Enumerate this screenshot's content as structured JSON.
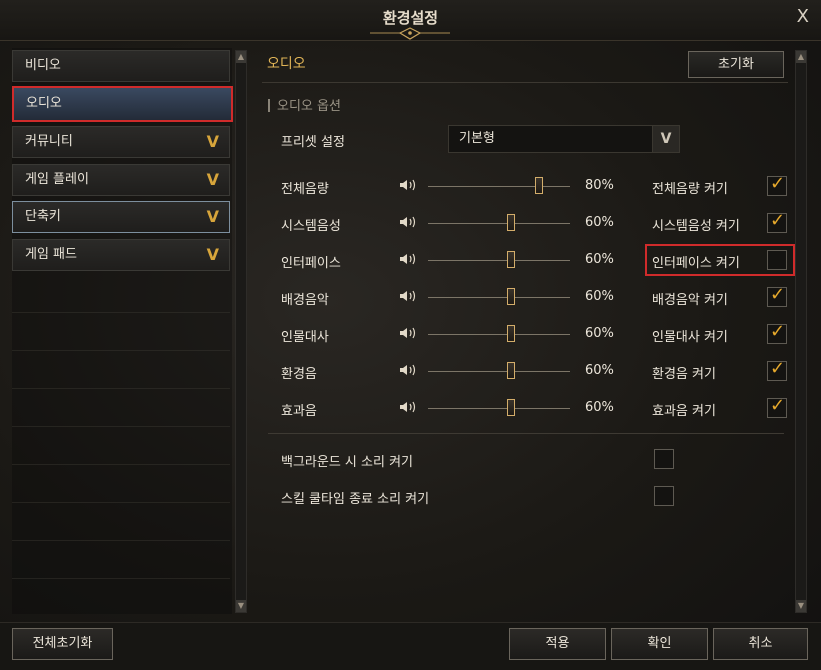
{
  "window": {
    "title": "환경설정",
    "close": "X"
  },
  "sidebar": {
    "items": [
      {
        "label": "비디오",
        "chevron": ""
      },
      {
        "label": "오디오",
        "chevron": ""
      },
      {
        "label": "커뮤니티",
        "chevron": "V"
      },
      {
        "label": "게임 플레이",
        "chevron": "V"
      },
      {
        "label": "단축키",
        "chevron": "V"
      },
      {
        "label": "게임 패드",
        "chevron": "V"
      }
    ],
    "selected": "오디오"
  },
  "content": {
    "section_title": "오디오",
    "reset_label": "초기화",
    "subheading": "오디오 옵션",
    "preset": {
      "label": "프리셋 설정",
      "value": "기본형",
      "dropdown_icon": "V"
    },
    "channels": [
      {
        "name": "전체음량",
        "value": 80,
        "value_text": "80%",
        "toggle_label": "전체음량 켜기",
        "enabled": true
      },
      {
        "name": "시스템음성",
        "value": 60,
        "value_text": "60%",
        "toggle_label": "시스템음성 켜기",
        "enabled": true
      },
      {
        "name": "인터페이스",
        "value": 60,
        "value_text": "60%",
        "toggle_label": "인터페이스 켜기",
        "enabled": false
      },
      {
        "name": "배경음악",
        "value": 60,
        "value_text": "60%",
        "toggle_label": "배경음악 켜기",
        "enabled": true
      },
      {
        "name": "인물대사",
        "value": 60,
        "value_text": "60%",
        "toggle_label": "인물대사 켜기",
        "enabled": true
      },
      {
        "name": "환경음",
        "value": 60,
        "value_text": "60%",
        "toggle_label": "환경음 켜기",
        "enabled": true
      },
      {
        "name": "효과음",
        "value": 60,
        "value_text": "60%",
        "toggle_label": "효과음 켜기",
        "enabled": true
      }
    ],
    "speaker_icon": "speaker-icon",
    "check_glyph": "✓",
    "extra_options": [
      {
        "label": "백그라운드 시 소리 켜기",
        "enabled": false
      },
      {
        "label": "스킬 쿨타임 종료 소리 켜기",
        "enabled": false
      }
    ]
  },
  "footer": {
    "reset_all": "전체초기화",
    "apply": "적용",
    "ok": "확인",
    "cancel": "취소"
  },
  "colors": {
    "accent": "#e0b457",
    "check": "#e6a92c",
    "highlight": "#d02b2b"
  }
}
